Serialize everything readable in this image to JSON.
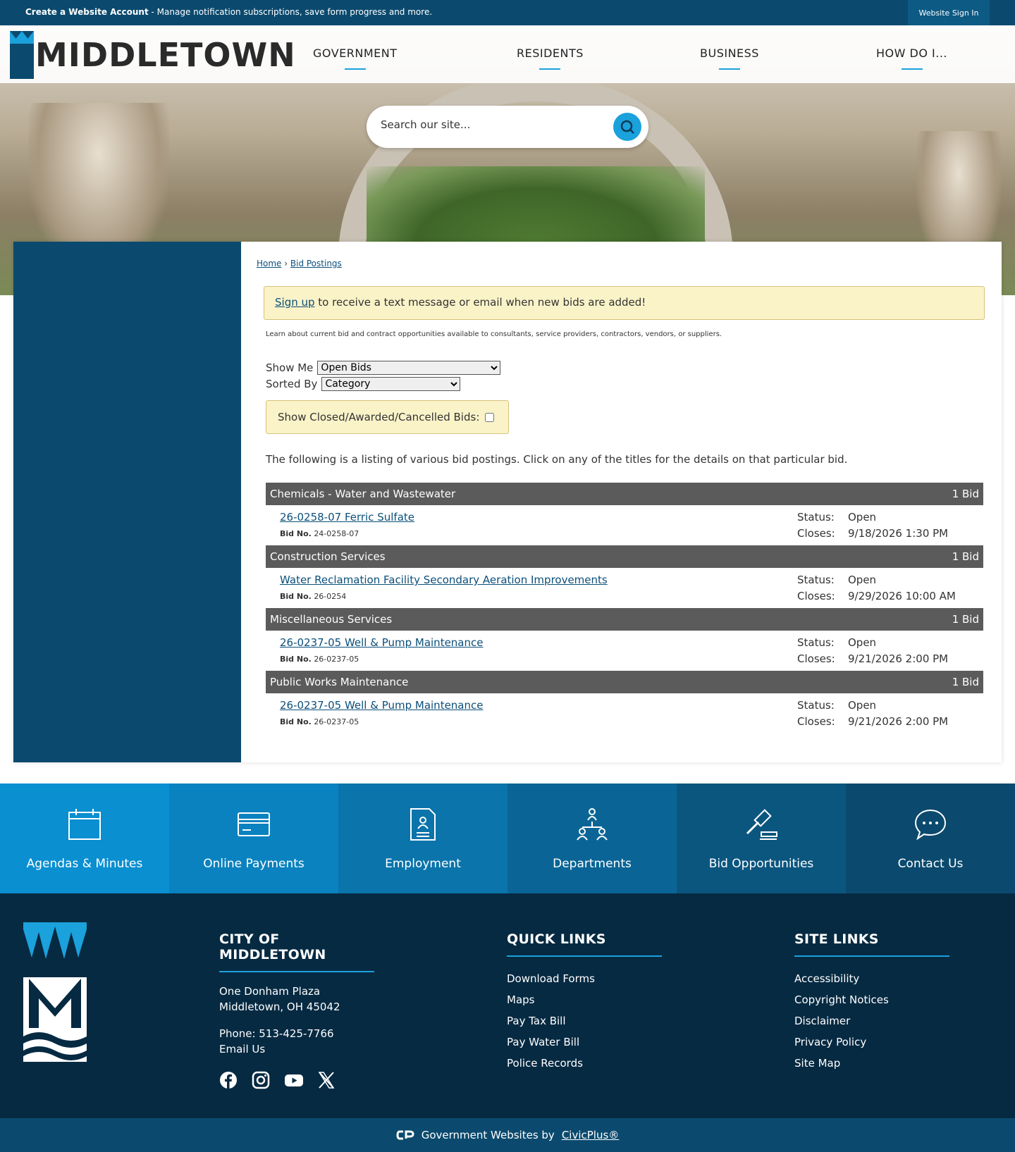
{
  "topbar": {
    "create_label": "Create a Website Account",
    "create_desc": " - Manage notification subscriptions, save form progress and more.",
    "signin_label": "Website Sign In"
  },
  "header": {
    "logo_text": "MIDDLETOWN",
    "nav": [
      "GOVERNMENT",
      "RESIDENTS",
      "BUSINESS",
      "HOW DO I..."
    ]
  },
  "search": {
    "placeholder": "Search our site..."
  },
  "breadcrumb": {
    "home": "Home",
    "current": "Bid Postings"
  },
  "alert": {
    "link": "Sign up",
    "text": " to receive a text message or email when new bids are added!"
  },
  "intro": "Learn about current bid and contract opportunities available to consultants, service providers, contractors, vendors, or suppliers.",
  "filters": {
    "show_me_label": "Show Me",
    "show_me_value": "Open Bids",
    "sorted_by_label": "Sorted By",
    "sorted_by_value": "Category",
    "closed_label": "Show Closed/Awarded/Cancelled Bids:"
  },
  "listing_intro": "The following is a listing of various bid postings. Click on any of the titles for the details on that particular bid.",
  "status_label": "Status:",
  "closes_label": "Closes:",
  "bid_no_label": "Bid No.",
  "categories": [
    {
      "name": "Chemicals - Water and Wastewater",
      "count": "1 Bid",
      "bid": {
        "title": "26-0258-07 Ferric Sulfate",
        "bid_no": "24-0258-07",
        "status": "Open",
        "closes": "9/18/2026 1:30 PM"
      }
    },
    {
      "name": "Construction Services",
      "count": "1 Bid",
      "bid": {
        "title": "Water Reclamation Facility Secondary Aeration Improvements",
        "bid_no": "26-0254",
        "status": "Open",
        "closes": "9/29/2026 10:00 AM"
      }
    },
    {
      "name": "Miscellaneous Services",
      "count": "1 Bid",
      "bid": {
        "title": "26-0237-05 Well & Pump Maintenance",
        "bid_no": "26-0237-05",
        "status": "Open",
        "closes": "9/21/2026 2:00 PM"
      }
    },
    {
      "name": "Public Works Maintenance",
      "count": "1 Bid",
      "bid": {
        "title": "26-0237-05 Well & Pump Maintenance",
        "bid_no": "26-0237-05",
        "status": "Open",
        "closes": "9/21/2026 2:00 PM"
      }
    }
  ],
  "tiles": [
    {
      "label": "Agendas & Minutes",
      "icon": "calendar-icon",
      "color": "#0a8fd0"
    },
    {
      "label": "Online Payments",
      "icon": "credit-card-icon",
      "color": "#0a82bf"
    },
    {
      "label": "Employment",
      "icon": "document-icon",
      "color": "#0a74ab"
    },
    {
      "label": "Departments",
      "icon": "org-chart-icon",
      "color": "#0a6596"
    },
    {
      "label": "Bid Opportunities",
      "icon": "gavel-icon",
      "color": "#0b567f"
    },
    {
      "label": "Contact Us",
      "icon": "chat-icon",
      "color": "#0b4a6e"
    }
  ],
  "footer": {
    "city_title": "CITY OF MIDDLETOWN",
    "address1": "One Donham Plaza",
    "address2": "Middletown, OH 45042",
    "phone": "Phone: 513-425-7766",
    "email": "Email Us",
    "quick_title": "QUICK LINKS",
    "quick_links": [
      "Download Forms",
      "Maps",
      "Pay Tax Bill",
      "Pay Water Bill",
      "Police Records"
    ],
    "site_title": "SITE LINKS",
    "site_links": [
      "Accessibility",
      "Copyright Notices",
      "Disclaimer",
      "Privacy Policy",
      "Site Map"
    ],
    "social": [
      "facebook-icon",
      "instagram-icon",
      "youtube-icon",
      "x-icon"
    ]
  },
  "bottombar": {
    "text": "Government Websites by",
    "link": "CivicPlus®"
  }
}
